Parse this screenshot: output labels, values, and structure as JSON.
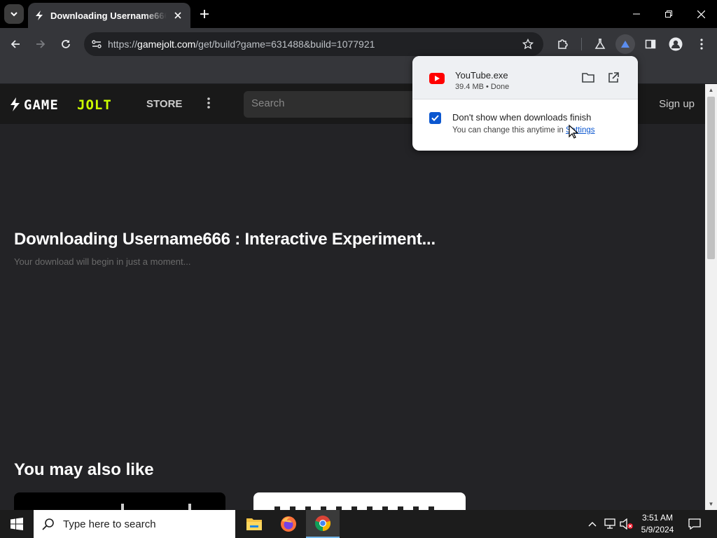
{
  "browser": {
    "tab_title": "Downloading Username666 : Interactive Experiment...",
    "url_host": "gamejolt.com",
    "url_prefix": "https://",
    "url_path": "/get/build?game=631488&build=1077921"
  },
  "site": {
    "logo_text": "GAME JOLT",
    "store_label": "STORE",
    "search_placeholder": "Search",
    "signup_label": "Sign up",
    "download_title": "Downloading Username666 : Interactive Experiment...",
    "download_subtitle": "Your download will begin in just a moment...",
    "recommend_heading": "You may also like"
  },
  "download_bubble": {
    "file_name": "YouTube.exe",
    "file_meta": "39.4 MB • Done",
    "checkbox_label": "Don't show when downloads finish",
    "checkbox_checked": true,
    "hint_prefix": "You can change this anytime in ",
    "hint_link": "Settings"
  },
  "taskbar": {
    "search_placeholder": "Type here to search",
    "time": "3:51 AM",
    "date": "5/9/2024"
  },
  "colors": {
    "accent": "#0b57d0",
    "youtube_red": "#ff0000",
    "gamejolt_green": "#ccff00"
  }
}
